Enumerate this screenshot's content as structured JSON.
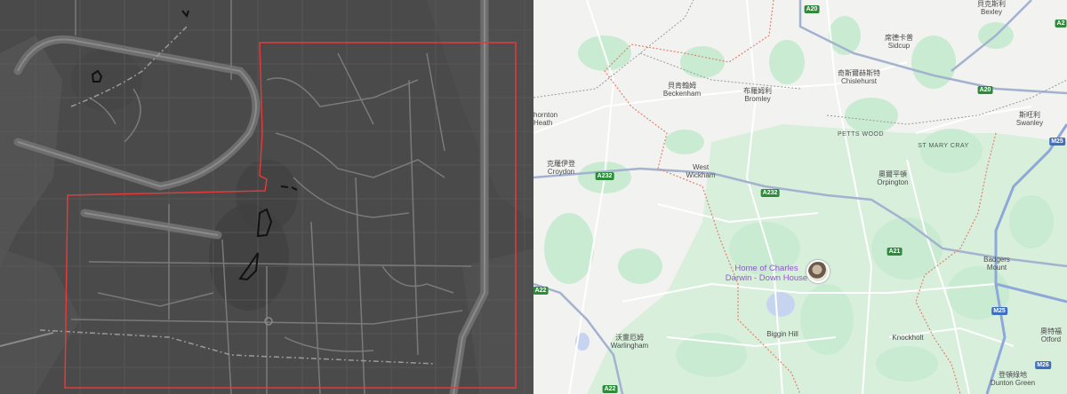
{
  "left_map": {
    "style": "dark-grey",
    "boundary_color": "#e23a3a"
  },
  "right_map": {
    "places": [
      {
        "id": "bexley",
        "zh": "貝克斯利",
        "en": "Bexley"
      },
      {
        "id": "sidcup",
        "zh": "席德卡普",
        "en": "Sidcup"
      },
      {
        "id": "chislehurst",
        "zh": "奇斯爾赫斯特",
        "en": "Chislehurst"
      },
      {
        "id": "beckenham",
        "zh": "貝肯翰姆",
        "en": "Beckenham"
      },
      {
        "id": "bromley",
        "zh": "布羅姆利",
        "en": "Bromley"
      },
      {
        "id": "thornton-heath",
        "zh": "",
        "en": "hornton\nHeath"
      },
      {
        "id": "swanley",
        "zh": "斯旺利",
        "en": "Swanley"
      },
      {
        "id": "petts-wood",
        "zh": "",
        "en": "PETTS WOOD"
      },
      {
        "id": "st-mary-cray",
        "zh": "",
        "en": "ST MARY CRAY"
      },
      {
        "id": "croydon",
        "zh": "克羅伊登",
        "en": "Croydon"
      },
      {
        "id": "west-wickham",
        "zh": "",
        "en": "West\nWickham"
      },
      {
        "id": "orpington",
        "zh": "奧爾平頓",
        "en": "Orpington"
      },
      {
        "id": "badgers-mount",
        "zh": "",
        "en": "Badgers\nMount"
      },
      {
        "id": "biggin-hill",
        "zh": "",
        "en": "Biggin Hill"
      },
      {
        "id": "warlingham",
        "zh": "沃靈厄姆",
        "en": "Warlingham"
      },
      {
        "id": "knockholt",
        "zh": "",
        "en": "Knockholt"
      },
      {
        "id": "otford",
        "zh": "奧特福",
        "en": "Otford"
      },
      {
        "id": "dunton-green",
        "zh": "登頓綠地",
        "en": "Dunton Green"
      }
    ],
    "road_shields": [
      {
        "id": "a20-top",
        "label": "A20",
        "kind": "a"
      },
      {
        "id": "a2",
        "label": "A2",
        "kind": "a"
      },
      {
        "id": "a20-right",
        "label": "A20",
        "kind": "a"
      },
      {
        "id": "m25-top",
        "label": "M25",
        "kind": "m"
      },
      {
        "id": "a232-left",
        "label": "A232",
        "kind": "a"
      },
      {
        "id": "a232-mid",
        "label": "A232",
        "kind": "a"
      },
      {
        "id": "a21",
        "label": "A21",
        "kind": "a"
      },
      {
        "id": "a22-left",
        "label": "A22",
        "kind": "a"
      },
      {
        "id": "m25-mid",
        "label": "M25",
        "kind": "m"
      },
      {
        "id": "m26",
        "label": "M26",
        "kind": "m"
      },
      {
        "id": "a22-bottom",
        "label": "A22",
        "kind": "a"
      }
    ],
    "poi": {
      "label_line1": "Home of Charles",
      "label_line2": "Darwin - Down House"
    },
    "colors": {
      "land": "#f2f2f0",
      "green": "#c9ebd2",
      "motorway": "#9fb3d6",
      "boundary": "#e0836f",
      "poi": "#8f58cc"
    }
  }
}
